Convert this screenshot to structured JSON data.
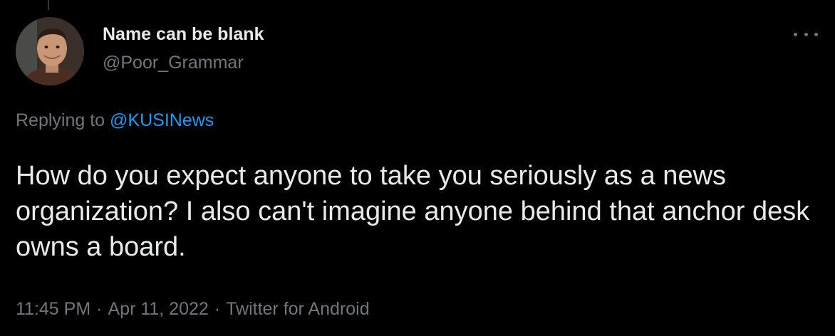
{
  "tweet": {
    "display_name": "Name can be blank",
    "handle": "@Poor_Grammar",
    "replying_prefix": "Replying to ",
    "replying_to": "@KUSINews",
    "text": "How do you expect anyone to take you seriously as a news organization? I also can't imagine anyone behind that anchor desk owns a board.",
    "time": "11:45 PM",
    "separator": "·",
    "date": "Apr 11, 2022",
    "source": "Twitter for Android"
  },
  "icons": {
    "more": "more-horizontal-icon",
    "avatar": "profile-photo"
  },
  "colors": {
    "background": "#000000",
    "primary_text": "#e7e9ea",
    "secondary_text": "#71767b",
    "link": "#1d9bf0"
  }
}
